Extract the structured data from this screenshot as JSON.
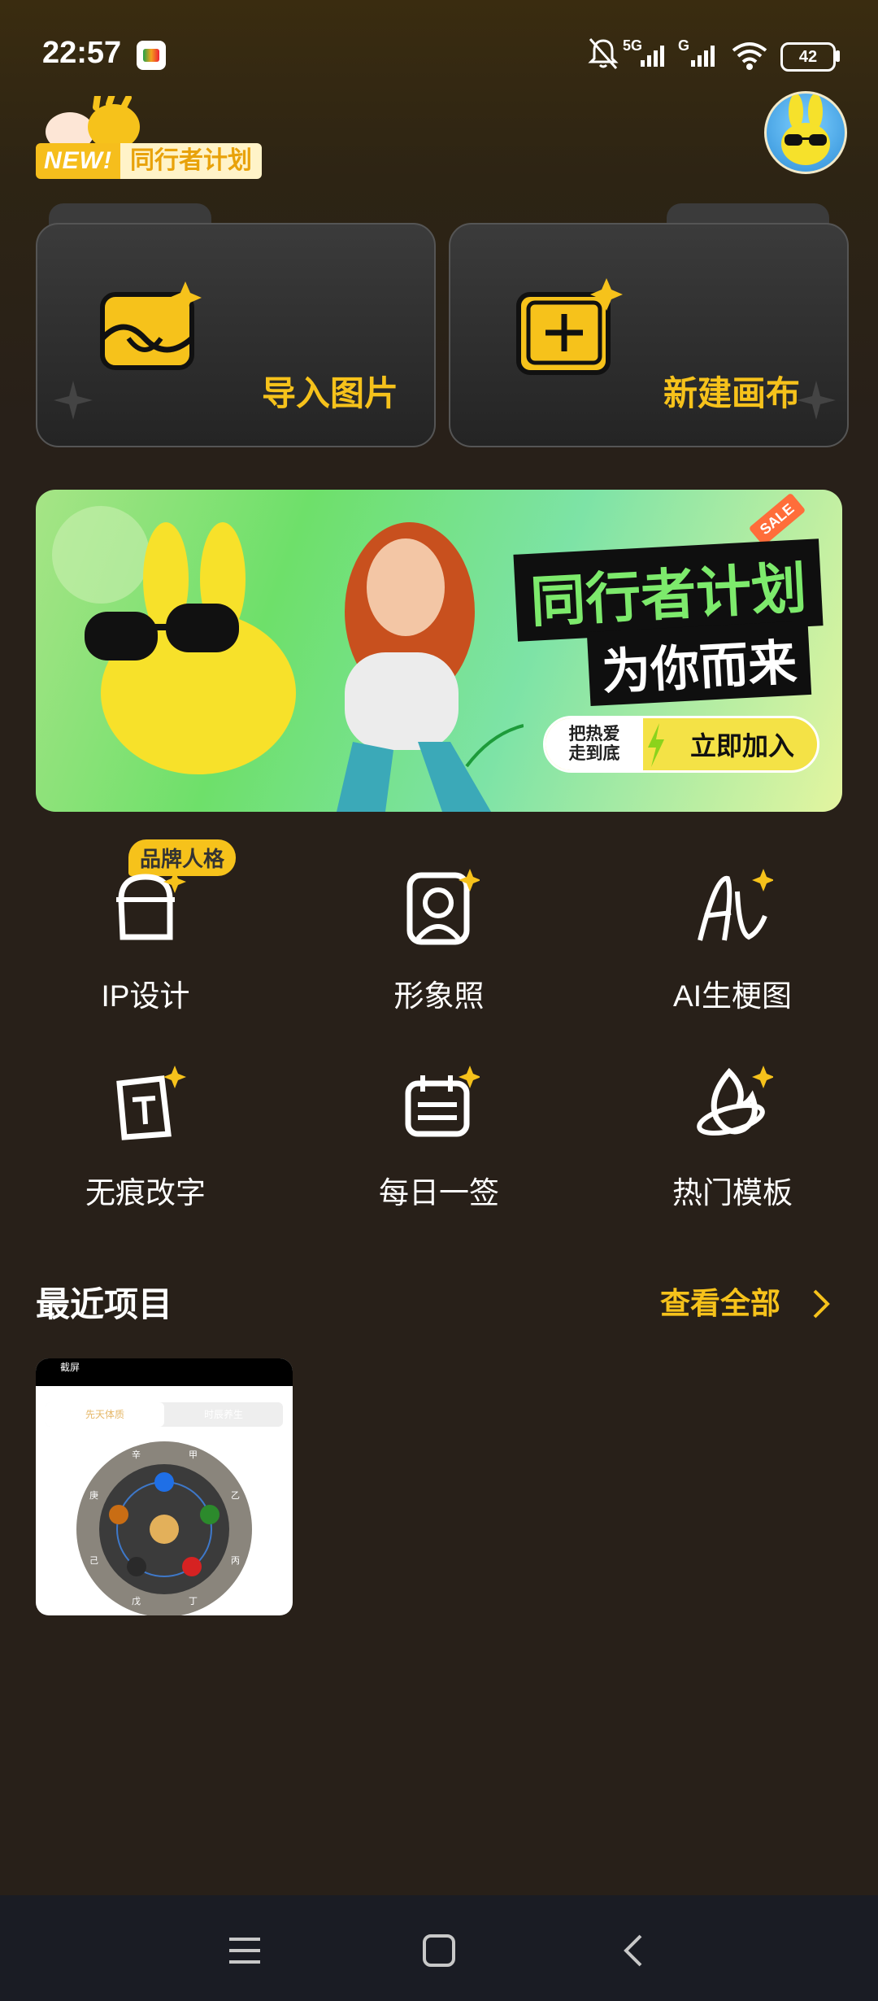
{
  "status_bar": {
    "time": "22:57",
    "network_1": "5G",
    "network_2": "G",
    "battery": "42"
  },
  "header": {
    "new_badge": "NEW!",
    "badge_label": "同行者计划"
  },
  "actions": [
    {
      "label": "导入图片",
      "icon": "import-image-icon"
    },
    {
      "label": "新建画布",
      "icon": "new-canvas-icon"
    }
  ],
  "banner": {
    "sale": "SALE",
    "title": "同行者计划",
    "subtitle": "为你而来",
    "pill_left_line1": "把热爱",
    "pill_left_line2": "走到底",
    "cta": "立即加入"
  },
  "features": {
    "badge": "品牌人格",
    "items": [
      {
        "label": "IP设计",
        "icon": "ip-design-icon"
      },
      {
        "label": "形象照",
        "icon": "portrait-icon"
      },
      {
        "label": "AI生梗图",
        "icon": "ai-meme-icon"
      },
      {
        "label": "无痕改字",
        "icon": "text-edit-icon"
      },
      {
        "label": "每日一签",
        "icon": "daily-sign-icon"
      },
      {
        "label": "热门模板",
        "icon": "hot-template-icon"
      }
    ]
  },
  "recent": {
    "title": "最近项目",
    "view_all": "查看全部",
    "thumb_header": "截屏",
    "thumb_tab_1": "先天体质",
    "thumb_tab_2": "时辰养生",
    "thumb_stems": [
      "甲",
      "乙",
      "丙",
      "丁",
      "戊",
      "己",
      "庚",
      "辛"
    ]
  },
  "colors": {
    "accent": "#f6c21b",
    "background": "#282019",
    "navbar": "#1a1c24"
  }
}
